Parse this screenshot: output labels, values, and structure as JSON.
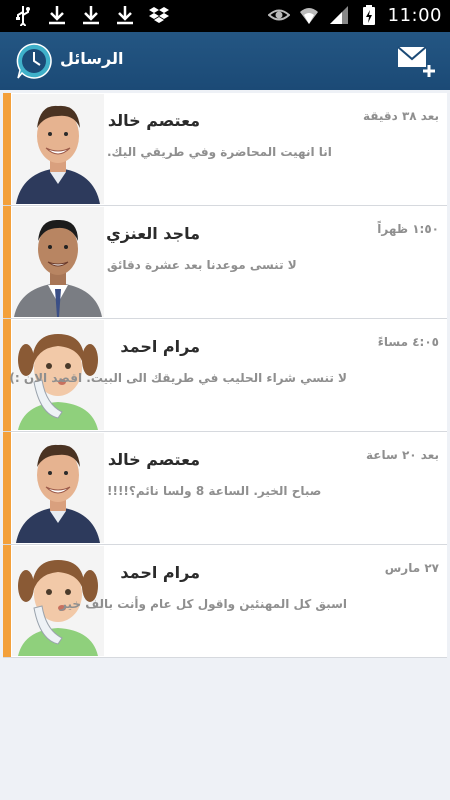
{
  "status_bar": {
    "clock": "11:00",
    "left_icons": [
      "usb-icon",
      "download-icon",
      "download-icon",
      "download-icon",
      "dropbox-icon"
    ],
    "right_icons": [
      "eye-icon",
      "wifi-icon",
      "signal-icon",
      "battery-charging-icon"
    ]
  },
  "app_bar": {
    "title": "الرسائل",
    "compose_icon": "compose-mail-icon",
    "logo_icon": "clock-chat-icon",
    "accent": "#f3a03b",
    "background": "#1f4e79"
  },
  "messages": [
    {
      "name": "معتصم خالد",
      "time": "بعد ٣٨ دقيقة",
      "text": "انا انهيت المحاضرة وفي طريقي اليك.",
      "avatar": "man-smiling-avatar"
    },
    {
      "name": "ماجد العنزي",
      "time": "١:٥٠ ظهراً",
      "text": "لا تنسى موعدنا بعد عشرة دقائق",
      "avatar": "man-suit-avatar"
    },
    {
      "name": "مرام احمد",
      "time": "٤:٠٥ مساءً",
      "text": "لا تنسي شراء الحليب في طريقك الى البيت. اقصد الان :)",
      "avatar": "girl-phone-avatar"
    },
    {
      "name": "معتصم خالد",
      "time": "بعد ٢٠ ساعة",
      "text": "صباح الخير. الساعة 8 ولسا نائم؟!!!!",
      "avatar": "man-smiling-avatar"
    },
    {
      "name": "مرام احمد",
      "time": "٢٧ مارس",
      "text": "اسبق كل المهنئين واقول كل عام وأنت بالف خير",
      "avatar": "girl-phone-avatar"
    }
  ]
}
